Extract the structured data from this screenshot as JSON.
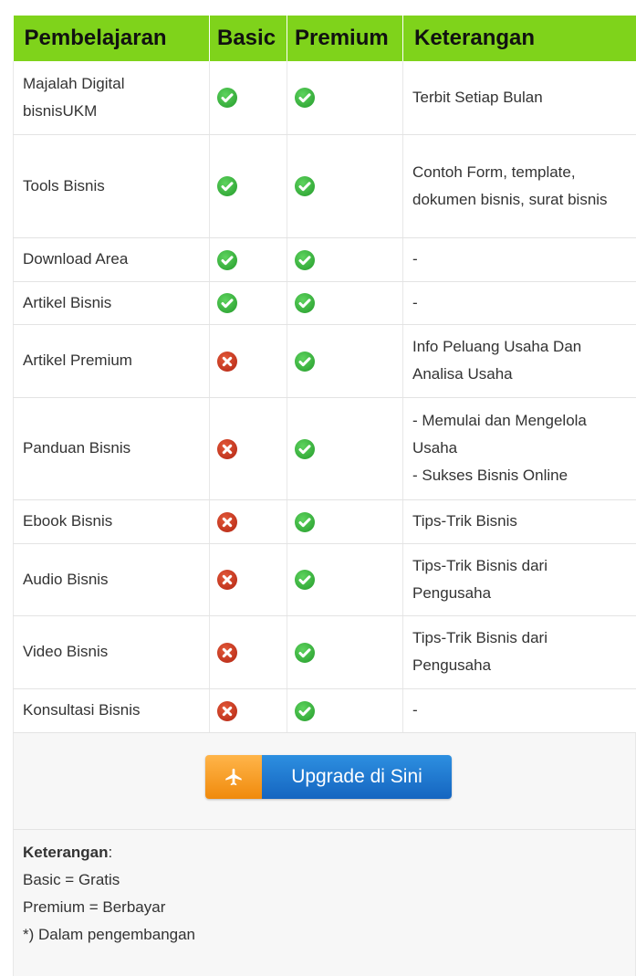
{
  "table": {
    "headers": [
      "Pembelajaran",
      "Basic",
      "Premium",
      "Keterangan"
    ],
    "rows": [
      {
        "name": "Majalah Digital bisnisUKM",
        "basic": "check",
        "premium": "check",
        "note": "Terbit Setiap Bulan"
      },
      {
        "name": "Tools Bisnis",
        "basic": "check",
        "premium": "check",
        "note": "Contoh Form, template, dokumen bisnis, surat bisnis"
      },
      {
        "name": "Download Area",
        "basic": "check",
        "premium": "check",
        "note": "-"
      },
      {
        "name": "Artikel Bisnis",
        "basic": "check",
        "premium": "check",
        "note": "-"
      },
      {
        "name": "Artikel Premium",
        "basic": "cross",
        "premium": "check",
        "note": "Info Peluang Usaha Dan Analisa Usaha"
      },
      {
        "name": "Panduan Bisnis",
        "basic": "cross",
        "premium": "check",
        "note": "- Memulai dan Mengelola Usaha\n- Sukses Bisnis Online"
      },
      {
        "name": "Ebook Bisnis",
        "basic": "cross",
        "premium": "check",
        "note": "Tips-Trik Bisnis"
      },
      {
        "name": "Audio Bisnis",
        "basic": "cross",
        "premium": "check",
        "note": "Tips-Trik Bisnis dari Pengusaha"
      },
      {
        "name": "Video Bisnis",
        "basic": "cross",
        "premium": "check",
        "note": "Tips-Trik Bisnis dari Pengusaha"
      },
      {
        "name": "Konsultasi Bisnis",
        "basic": "cross",
        "premium": "check",
        "note": "-"
      }
    ]
  },
  "upgrade_button": {
    "label": "Upgrade di Sini",
    "icon": "airplane-icon"
  },
  "notes": {
    "heading": "Keterangan",
    "heading_suffix": ":",
    "lines": [
      "Basic = Gratis",
      "Premium = Berbayar",
      "*) Dalam pengembangan"
    ]
  },
  "colors": {
    "header_bg": "#7fd31b",
    "check": "#2ea836",
    "cross": "#c8321a",
    "button_orange": "#f5a02a",
    "button_blue": "#1e78d2"
  }
}
